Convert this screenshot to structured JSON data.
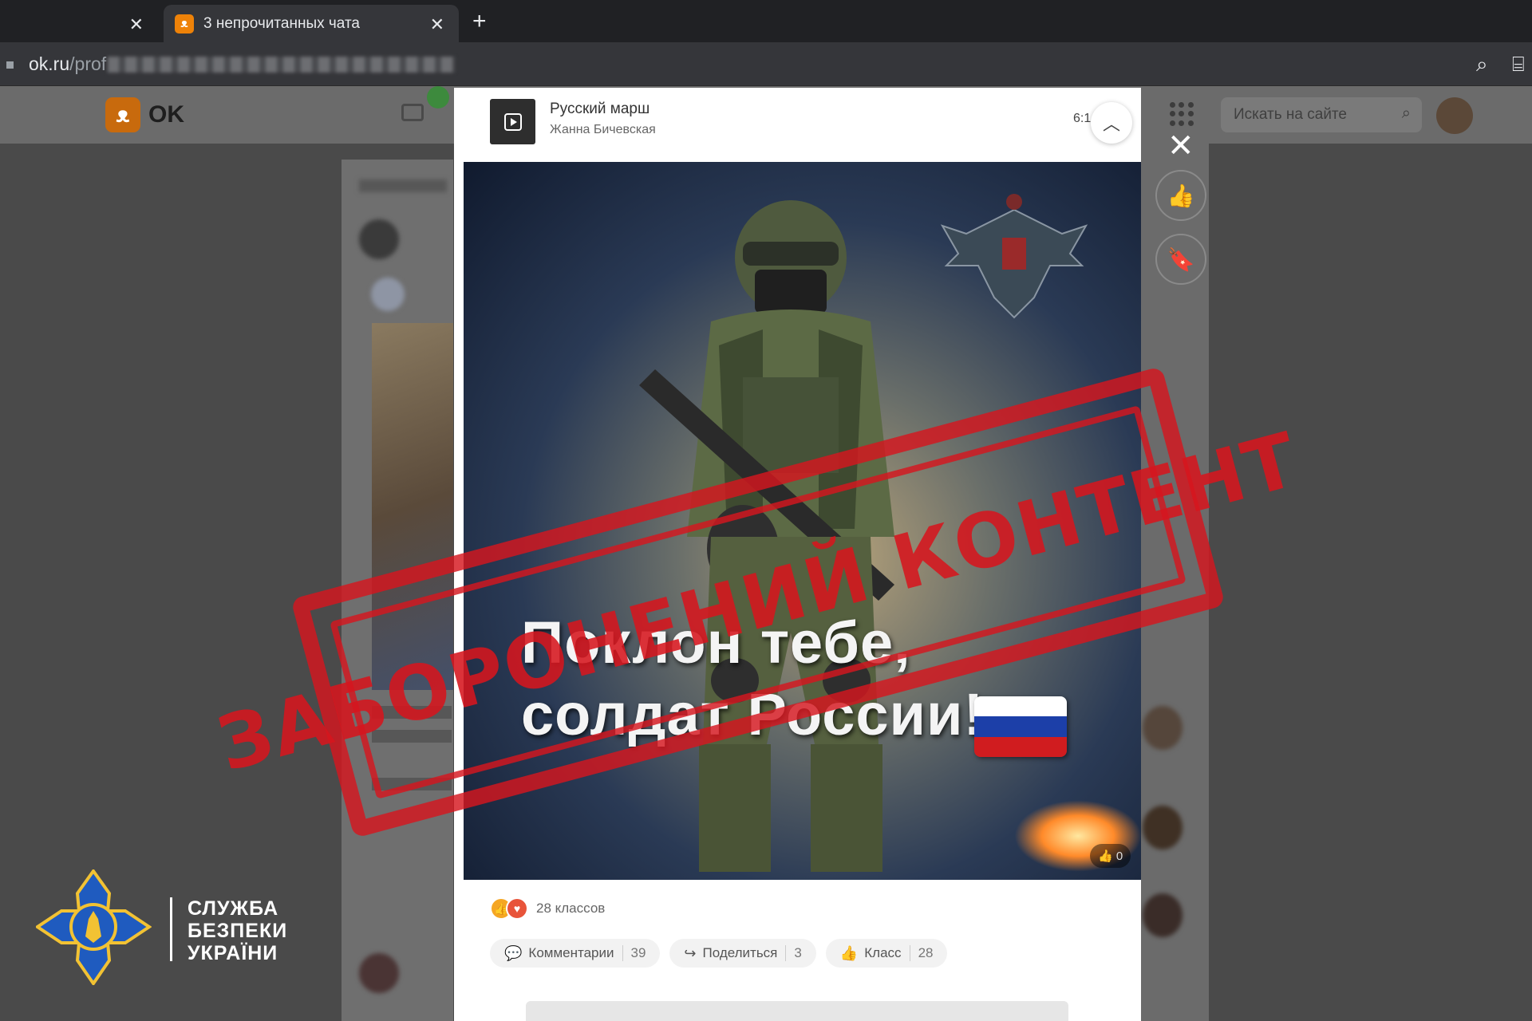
{
  "browser": {
    "active_tab_title": "3 непрочитанных чата",
    "url_host": "ok.ru",
    "url_path": "/prof",
    "close_glyph": "✕",
    "new_tab_glyph": "+"
  },
  "ok_header": {
    "logo_text": "OK",
    "search_placeholder": "Искать на сайте"
  },
  "modal": {
    "track": {
      "title": "Русский марш",
      "artist": "Жанна Бичевская",
      "time": "6:1"
    },
    "poster": {
      "line1": "Поклон тебе,",
      "line2": "солдат России!",
      "flag_colors": [
        "#ffffff",
        "#1c3fa8",
        "#d01c1f"
      ],
      "like_chip": "0"
    },
    "reactions": {
      "count_label": "28 классов"
    },
    "actions": [
      {
        "label": "Комментарии",
        "count": "39",
        "icon": "comment-icon"
      },
      {
        "label": "Поделиться",
        "count": "3",
        "icon": "share-icon"
      },
      {
        "label": "Класс",
        "count": "28",
        "icon": "like-icon"
      }
    ]
  },
  "stamp": {
    "text": "ЗАБОРОНЕНИЙ КОНТЕНТ",
    "color": "#d6161e"
  },
  "watermark": {
    "line1": "СЛУЖБА",
    "line2": "БЕЗПЕКИ",
    "line3": "УКРАЇНИ",
    "emblem_color": "#1f5bbf",
    "emblem_accent": "#f2c233"
  }
}
